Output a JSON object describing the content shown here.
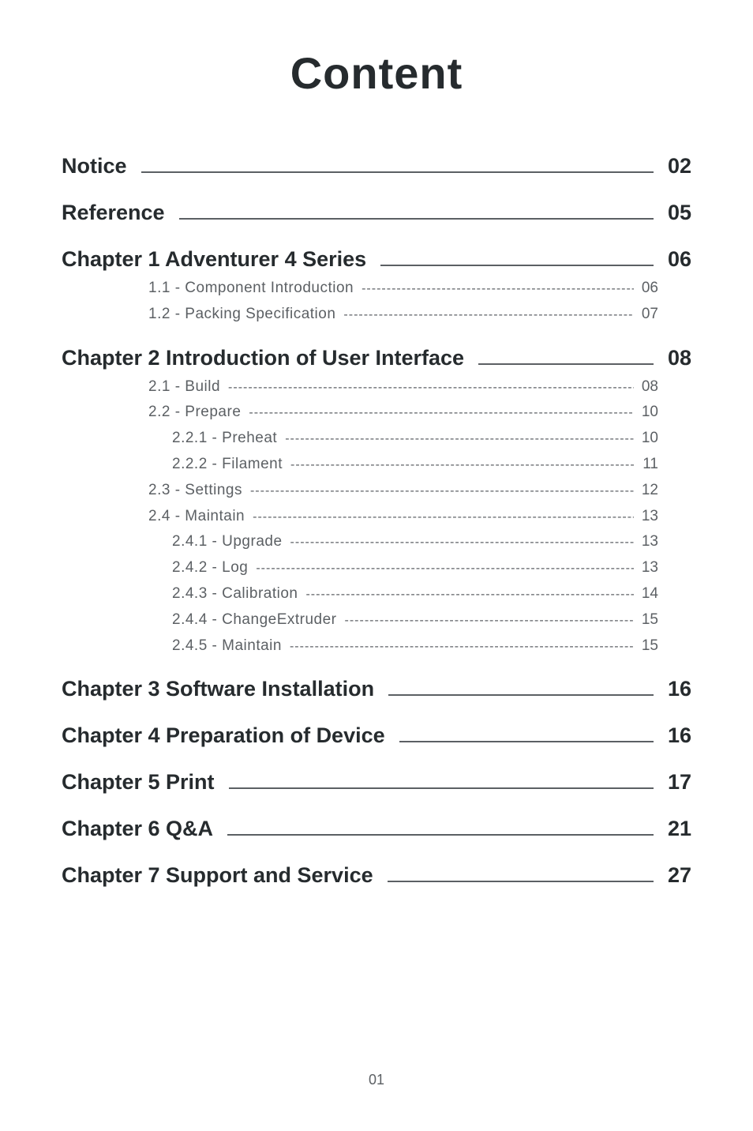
{
  "title": "Content",
  "dots": "------------------------------------------------------------------------------------------------------------",
  "footer_page": "01",
  "toc": {
    "majors": [
      {
        "label": "Notice",
        "page": "02",
        "subs": []
      },
      {
        "label": "Reference",
        "page": "05",
        "subs": []
      },
      {
        "label": "Chapter 1 Adventurer 4 Series",
        "page": "06",
        "subs": [
          {
            "label": "1.1 - Component Introduction",
            "page": "06",
            "indent": 1
          },
          {
            "label": "1.2 - Packing Specification",
            "page": "07",
            "indent": 1
          }
        ]
      },
      {
        "label": "Chapter 2 Introduction of User Interface",
        "page": "08",
        "subs": [
          {
            "label": "2.1 - Build",
            "page": "08",
            "indent": 1
          },
          {
            "label": "2.2 - Prepare",
            "page": "10",
            "indent": 1
          },
          {
            "label": "2.2.1 - Preheat",
            "page": "10",
            "indent": 2
          },
          {
            "label": "2.2.2 - Filament",
            "page": "11",
            "indent": 2
          },
          {
            "label": "2.3 - Settings",
            "page": "12",
            "indent": 1
          },
          {
            "label": "2.4 - Maintain",
            "page": "13",
            "indent": 1
          },
          {
            "label": "2.4.1 - Upgrade",
            "page": "13",
            "indent": 2
          },
          {
            "label": "2.4.2 - Log",
            "page": "13",
            "indent": 2
          },
          {
            "label": "2.4.3 - Calibration",
            "page": "14",
            "indent": 2
          },
          {
            "label": "2.4.4 - ChangeExtruder",
            "page": "15",
            "indent": 2
          },
          {
            "label": "2.4.5 - Maintain",
            "page": "15",
            "indent": 2
          }
        ]
      },
      {
        "label": "Chapter 3 Software Installation",
        "page": "16",
        "subs": []
      },
      {
        "label": "Chapter 4 Preparation of Device",
        "page": "16",
        "subs": []
      },
      {
        "label": "Chapter 5 Print",
        "page": "17",
        "subs": []
      },
      {
        "label": "Chapter 6 Q&A",
        "page": "21",
        "subs": []
      },
      {
        "label": "Chapter 7 Support and Service",
        "page": "27",
        "subs": []
      }
    ]
  }
}
